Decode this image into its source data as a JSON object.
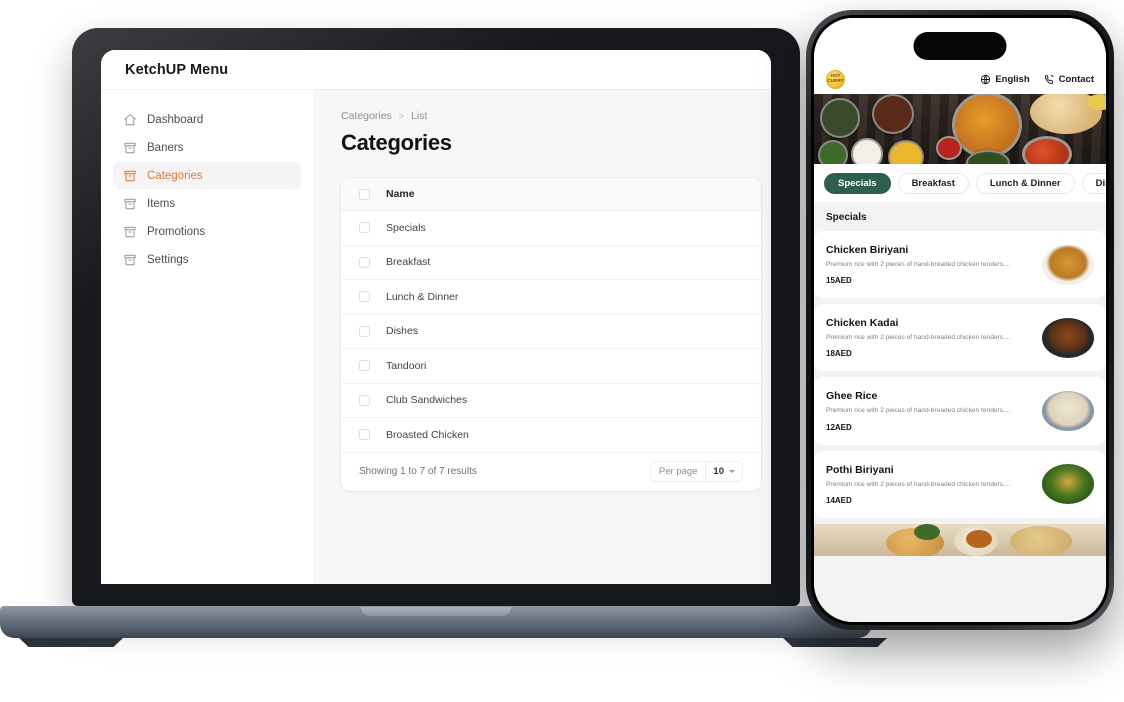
{
  "laptop": {
    "app_title": "KetchUP Menu",
    "sidebar": {
      "items": [
        {
          "label": "Dashboard",
          "icon": "home-icon",
          "active": false
        },
        {
          "label": "Baners",
          "icon": "archive-icon",
          "active": false
        },
        {
          "label": "Categories",
          "icon": "archive-icon",
          "active": true
        },
        {
          "label": "Items",
          "icon": "archive-icon",
          "active": false
        },
        {
          "label": "Promotions",
          "icon": "archive-icon",
          "active": false
        },
        {
          "label": "Settings",
          "icon": "archive-icon",
          "active": false
        }
      ]
    },
    "breadcrumb": {
      "parent": "Categories",
      "separator": ">",
      "current": "List"
    },
    "page_title": "Categories",
    "table": {
      "columns": [
        "Name"
      ],
      "rows": [
        {
          "name": "Specials"
        },
        {
          "name": "Breakfast"
        },
        {
          "name": "Lunch & Dinner"
        },
        {
          "name": "Dishes"
        },
        {
          "name": "Tandoori"
        },
        {
          "name": "Club Sandwiches"
        },
        {
          "name": "Broasted Chicken"
        }
      ],
      "footer": {
        "showing": "Showing 1 to 7 of 7 results",
        "per_page_label": "Per page",
        "per_page_value": "10"
      }
    },
    "accent_color": "#dd7a3c"
  },
  "phone": {
    "logo_text": "HOT CURRY",
    "header": {
      "language": "English",
      "language_icon": "globe-icon",
      "contact": "Contact",
      "contact_icon": "phone-icon"
    },
    "tabs": [
      {
        "label": "Specials",
        "active": true
      },
      {
        "label": "Breakfast",
        "active": false
      },
      {
        "label": "Lunch & Dinner",
        "active": false
      },
      {
        "label": "Dishes",
        "active": false
      }
    ],
    "section_title": "Specials",
    "menu_items": [
      {
        "name": "Chicken Biriyani",
        "desc": "Premium rice with 2 pieces of hand-breaded chicken tenders....",
        "price": "15AED"
      },
      {
        "name": "Chicken Kadai",
        "desc": "Premium rice with 2 pieces of hand-breaded chicken tenders....",
        "price": "18AED"
      },
      {
        "name": "Ghee Rice",
        "desc": "Premium rice with 2 pieces of hand-breaded chicken tenders....",
        "price": "12AED"
      },
      {
        "name": "Pothi Biriyani",
        "desc": "Premium rice with 2 pieces of hand-breaded chicken tenders....",
        "price": "14AED"
      }
    ],
    "accent_color": "#2e5f4e"
  }
}
